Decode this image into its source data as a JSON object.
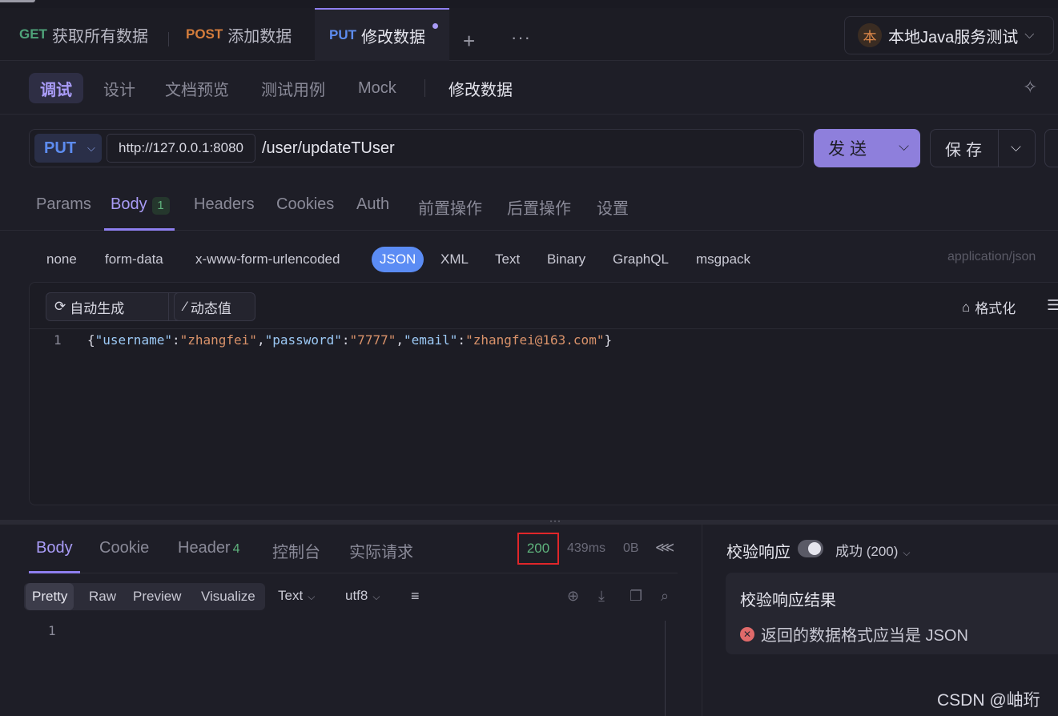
{
  "tabs": [
    {
      "method": "GET",
      "label": "获取所有数据"
    },
    {
      "method": "POST",
      "label": "添加数据"
    },
    {
      "method": "PUT",
      "label": "修改数据"
    }
  ],
  "env": {
    "badge": "本",
    "label": "本地Java服务测试"
  },
  "subnav": {
    "items": [
      "调试",
      "设计",
      "文档预览",
      "测试用例",
      "Mock"
    ],
    "title": "修改数据"
  },
  "request": {
    "method": "PUT",
    "base_url": "http://127.0.0.1:8080",
    "path": "/user/updateTUser",
    "send_label": "发送",
    "save_label": "保存"
  },
  "param_tabs": [
    "Params",
    "Body",
    "Headers",
    "Cookies",
    "Auth",
    "前置操作",
    "后置操作",
    "设置"
  ],
  "body_badge": "1",
  "body_types": [
    "none",
    "form-data",
    "x-www-form-urlencoded",
    "JSON",
    "XML",
    "Text",
    "Binary",
    "GraphQL",
    "msgpack"
  ],
  "content_type": "application/json",
  "editor": {
    "autogen_label": "自动生成",
    "dynamic_label": "动态值",
    "format_label": "格式化",
    "line_no": "1",
    "body_json": {
      "username": "zhangfei",
      "password": "7777",
      "email": "zhangfei@163.com"
    }
  },
  "response": {
    "tabs": [
      "Body",
      "Cookie",
      "Header",
      "控制台",
      "实际请求"
    ],
    "header_count": "4",
    "status": "200",
    "time": "439ms",
    "size": "0B",
    "view_modes": [
      "Pretty",
      "Raw",
      "Preview",
      "Visualize"
    ],
    "format": "Text",
    "encoding": "utf8",
    "line_no": "1"
  },
  "validation": {
    "title": "校验响应",
    "status": "成功 (200)",
    "result_title": "校验响应结果",
    "error": "返回的数据格式应当是 JSON"
  },
  "watermark": "CSDN @岫珩"
}
